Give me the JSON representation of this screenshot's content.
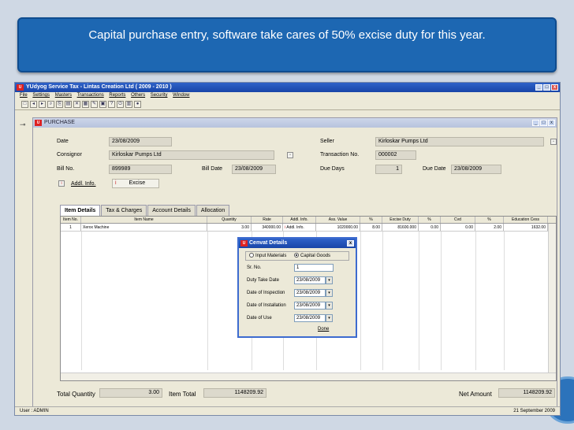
{
  "banner": {
    "text": "Capital purchase entry, software take cares of 50% excise duty for this year."
  },
  "app": {
    "title": "YUdyog Service Tax  -  Lintas Creation Ltd ( 2009 - 2010 )",
    "menu": [
      "File",
      "Settings",
      "Masters",
      "Transactions",
      "Reports",
      "Others",
      "Security",
      "Window"
    ],
    "toolbar_icons": [
      "new-icon",
      "prev-icon",
      "next-icon",
      "find-icon",
      "copy-icon",
      "paste-icon",
      "delete-icon",
      "print-icon",
      "edit-icon",
      "save-icon",
      "help-icon",
      "exit-icon",
      "calc-icon",
      "lock-icon"
    ]
  },
  "purchase": {
    "title": "PURCHASE",
    "date_label": "Date",
    "date": "23/08/2009",
    "consignor_label": "Consignor",
    "consignor": "Kirloskar Pumps Ltd",
    "bill_no_label": "Bill No.",
    "bill_no": "899989",
    "bill_date_label": "Bill Date",
    "bill_date": "23/08/2009",
    "addl_info_label": "Addl. Info.",
    "excise_label": "Excise",
    "seller_label": "Seller",
    "seller": "Kirloskar Pumps Ltd",
    "transaction_label": "Transaction No.",
    "transaction_no": "000002",
    "due_days_label": "Due Days",
    "due_days": "1",
    "due_date_label": "Due Date",
    "due_date": "23/08/2009",
    "tabs": [
      "Item Details",
      "Tax & Charges",
      "Account Details",
      "Allocation"
    ],
    "columns": [
      "Item No.",
      "Item Name",
      "Quantity",
      "Rate",
      "Addl. Info.",
      "Ass. Value",
      "%",
      "Excise Duty",
      "%",
      "Cvd",
      "%",
      "Education Cess"
    ],
    "row": [
      "1",
      "Xerox Machine",
      "3.00",
      "340000.00",
      "Addl. Info.",
      "1020000.00",
      "8.00",
      "81600.000",
      "0.00",
      "0.00",
      "2.00",
      "1632.00"
    ],
    "total_qty_label": "Total Quantity",
    "total_qty": "3.00",
    "item_total_label": "Item Total",
    "item_total": "1148209.92",
    "net_amount_label": "Net Amount",
    "net_amount": "1148209.92"
  },
  "dialog": {
    "title": "Cenvat Details",
    "option1": "Input Materials",
    "option2": "Capital Goods",
    "sr_label": "Sr. No.",
    "sr": "1",
    "duty_label": "Duty Take Date",
    "duty": "23/08/2009",
    "insp_label": "Date of Inspection",
    "insp": "23/08/2009",
    "inst_label": "Date  of Installation",
    "inst": "23/08/2009",
    "use_label": "Date of Use",
    "use": "23/08/2009",
    "done_label": "Done"
  },
  "status": {
    "user": "User : ADMIN",
    "date": "21 September 2009"
  }
}
